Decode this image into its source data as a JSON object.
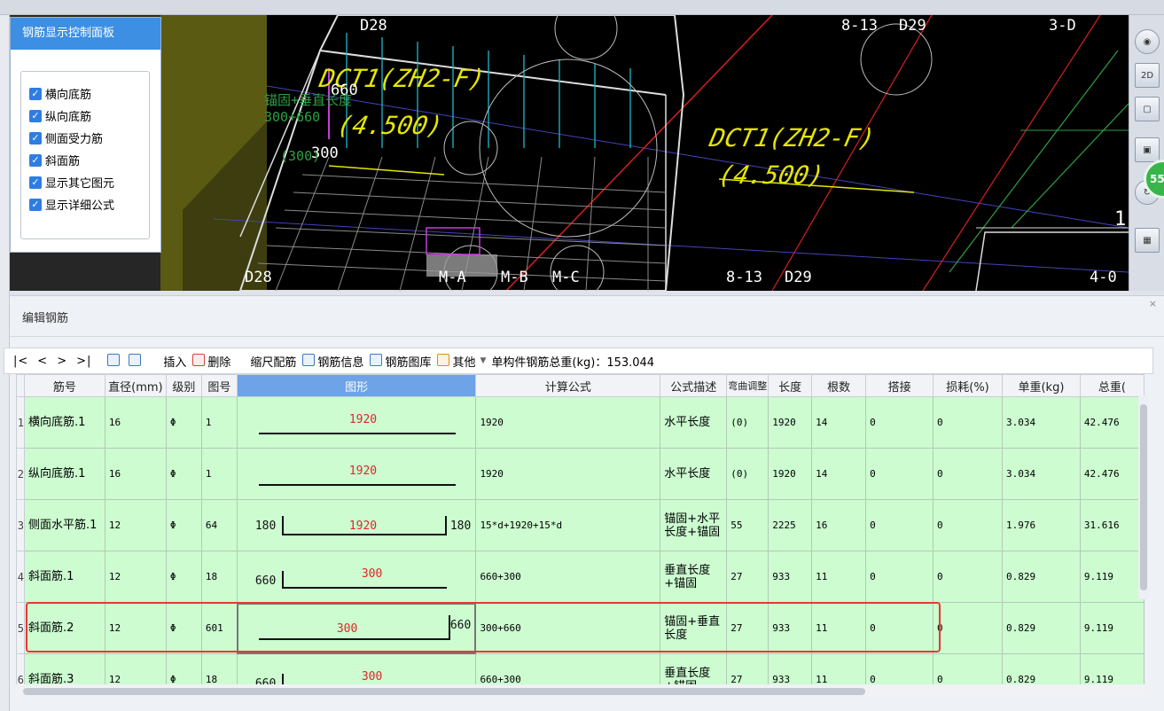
{
  "control_panel": {
    "title": "钢筋显示控制面板",
    "options": [
      {
        "label": "横向底筋",
        "checked": true
      },
      {
        "label": "纵向底筋",
        "checked": true
      },
      {
        "label": "侧面受力筋",
        "checked": true
      },
      {
        "label": "斜面筋",
        "checked": true
      },
      {
        "label": "显示其它图元",
        "checked": true
      },
      {
        "label": "显示详细公式",
        "checked": true
      }
    ]
  },
  "viewport": {
    "labels": {
      "d28_top": "D28",
      "axis_813_top": "8-13",
      "d29_top": "D29",
      "axis_3d": "3-D",
      "dct_left": "DCT1(ZH2-F)",
      "elev_left": "(4.500)",
      "dct_right": "DCT1(ZH2-F)",
      "elev_right": "(4.500)",
      "n660": "660",
      "n300": "300",
      "green1": "锚固+垂直长度",
      "green2": "300+660",
      "green3": "(300)",
      "d28_bottom": "D28",
      "m_a": "M-A",
      "m_b": "M-B",
      "m_c": "M-C",
      "axis_813_bottom": "8-13",
      "d29_bottom": "D29",
      "axis_40": "4-0",
      "num_1": "1"
    },
    "badge": "55"
  },
  "toolbar_icons": [
    "sphere-icon",
    "2d-view-icon",
    "front-view-icon",
    "iso-view-icon",
    "rotate-icon",
    "layout-icon"
  ],
  "editor": {
    "title": "编辑钢筋",
    "toolbar": {
      "nav": [
        "|<",
        "<",
        ">",
        ">|"
      ],
      "insert": "插入",
      "delete": "删除",
      "scale": "缩尺配筋",
      "info": "钢筋信息",
      "library": "钢筋图库",
      "other": "其他",
      "total_label": "单构件钢筋总重(kg)：153.044"
    },
    "columns": [
      "筋号",
      "直径(mm)",
      "级别",
      "图号",
      "图形",
      "计算公式",
      "公式描述",
      "弯曲调整",
      "长度",
      "根数",
      "搭接",
      "损耗(%)",
      "单重(kg)",
      "总重("
    ],
    "rows": [
      {
        "num": "1",
        "name": "横向底筋.1",
        "diameter": "16",
        "grade": "Φ",
        "fig": "1",
        "shape": {
          "type": "straight",
          "mid": "1920"
        },
        "formula": "1920",
        "desc": "水平长度",
        "bend": "(0)",
        "length": "1920",
        "count": "14",
        "lap": "0",
        "loss": "0",
        "unit": "3.034",
        "total": "42.476"
      },
      {
        "num": "2",
        "name": "纵向底筋.1",
        "diameter": "16",
        "grade": "Φ",
        "fig": "1",
        "shape": {
          "type": "straight",
          "mid": "1920"
        },
        "formula": "1920",
        "desc": "水平长度",
        "bend": "(0)",
        "length": "1920",
        "count": "14",
        "lap": "0",
        "loss": "0",
        "unit": "3.034",
        "total": "42.476"
      },
      {
        "num": "3",
        "name": "侧面水平筋.1",
        "diameter": "12",
        "grade": "Φ",
        "fig": "64",
        "shape": {
          "type": "u",
          "left": "180",
          "mid": "1920",
          "right": "180"
        },
        "formula": "15*d+1920+15*d",
        "desc": "锚固+水平长度+锚固",
        "bend": "55",
        "length": "2225",
        "count": "16",
        "lap": "0",
        "loss": "0",
        "unit": "1.976",
        "total": "31.616"
      },
      {
        "num": "4",
        "name": "斜面筋.1",
        "diameter": "12",
        "grade": "Φ",
        "fig": "18",
        "shape": {
          "type": "left-hook",
          "left": "660",
          "mid": "300"
        },
        "formula": "660+300",
        "desc": "垂直长度+锚固",
        "bend": "27",
        "length": "933",
        "count": "11",
        "lap": "0",
        "loss": "0",
        "unit": "0.829",
        "total": "9.119"
      },
      {
        "num": "5",
        "name": "斜面筋.2",
        "diameter": "12",
        "grade": "Φ",
        "fig": "601",
        "shape": {
          "type": "right-hook",
          "mid": "300",
          "right": "660"
        },
        "formula": "300+660",
        "desc": "锚固+垂直长度",
        "bend": "27",
        "length": "933",
        "count": "11",
        "lap": "0",
        "loss": "0",
        "unit": "0.829",
        "total": "9.119"
      },
      {
        "num": "6",
        "name": "斜面筋.3",
        "diameter": "12",
        "grade": "Φ",
        "fig": "18",
        "shape": {
          "type": "left-hook",
          "left": "660",
          "mid": "300"
        },
        "formula": "660+300",
        "desc": "垂直长度+锚固",
        "bend": "27",
        "length": "933",
        "count": "11",
        "lap": "0",
        "loss": "0",
        "unit": "0.829",
        "total": "9.119"
      }
    ]
  }
}
